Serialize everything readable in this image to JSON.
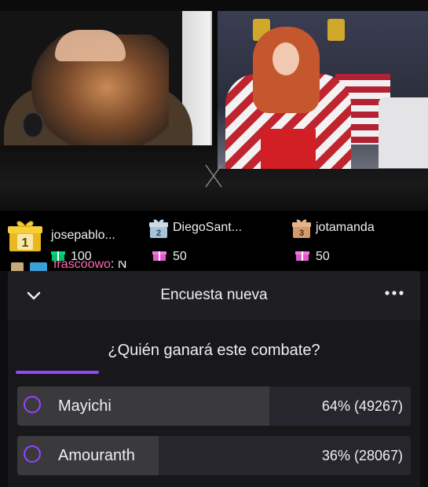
{
  "leaderboard": [
    {
      "rank": "1",
      "name": "josepablo...",
      "count": "100",
      "medal_color": "#e9b820",
      "icon": "gift-rank-1-icon"
    },
    {
      "rank": "2",
      "name": "DiegoSant...",
      "count": "50",
      "medal_color": "#a9c3d6",
      "icon": "gift-rank-2-icon"
    },
    {
      "rank": "3",
      "name": "jotamanda",
      "count": "50",
      "medal_color": "#d39a6a",
      "icon": "gift-rank-3-icon"
    }
  ],
  "chat_peek": {
    "user": "frascoowo",
    "message": "N"
  },
  "poll": {
    "header_title": "Encuesta nueva",
    "question": "¿Quién ganará este combate?",
    "options": [
      {
        "label": "Mayichi",
        "percent": 64,
        "result": "64% (49267)"
      },
      {
        "label": "Amouranth",
        "percent": 36,
        "result": "36% (28067)"
      }
    ]
  },
  "colors": {
    "accent": "#9147ff",
    "background": "#0e0e10",
    "panel": "#18181b"
  }
}
